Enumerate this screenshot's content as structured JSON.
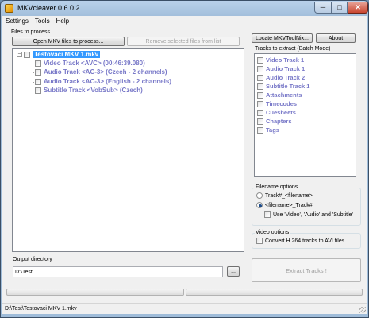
{
  "window": {
    "title": "MKVcleaver 0.6.0.2"
  },
  "menu": [
    "Settings",
    "Tools",
    "Help"
  ],
  "files": {
    "group_label": "Files to process",
    "open_button": "Open MKV files to process...",
    "remove_button": "Remove selected files from list",
    "root": "Testovaci MKV 1.mkv",
    "tracks": [
      "Video Track <AVC> (00:46:39.080)",
      "Audio Track <AC-3> (Czech - 2 channels)",
      "Audio Track <AC-3> (English - 2 channels)",
      "Subtitle Track <VobSub> (Czech)"
    ]
  },
  "toolbar_right": {
    "locate_button": "Locate MKVToolNix...",
    "about_button": "About"
  },
  "extract": {
    "label": "Tracks to extract (Batch Mode)",
    "items": [
      "Video Track 1",
      "Audio Track 1",
      "Audio Track 2",
      "Subtitle Track 1",
      "Attachments",
      "Timecodes",
      "Cuesheets",
      "Chapters",
      "Tags"
    ]
  },
  "filename_options": {
    "label": "Filename options",
    "opt1": "Track#_<filename>",
    "opt2": "<filename>_Track#",
    "use_label": "Use 'Video', 'Audio' and 'Subtitle'",
    "selected": 2
  },
  "video_options": {
    "label": "Video options",
    "convert": "Convert H.264 tracks to AVI files"
  },
  "output": {
    "label": "Output directory",
    "value": "D:\\Test",
    "browse": "..."
  },
  "extract_button": "Extract Tracks !",
  "status": "D:\\Test\\Testovaci MKV 1.mkv"
}
